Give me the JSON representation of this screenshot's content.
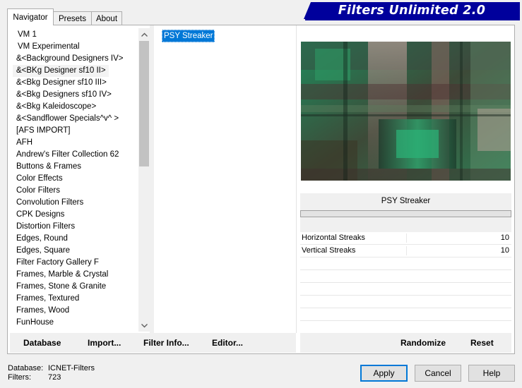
{
  "app": {
    "title": "Filters Unlimited 2.0"
  },
  "tabs": [
    {
      "label": "Navigator"
    },
    {
      "label": "Presets"
    },
    {
      "label": "About"
    }
  ],
  "categories": [
    "VM 1",
    "VM Experimental",
    "&<Background Designers IV>",
    "&<BKg Designer sf10 II>",
    "&<Bkg Designer sf10 III>",
    "&<Bkg Designers sf10 IV>",
    "&<Bkg Kaleidoscope>",
    "&<Sandflower Specials^v^ >",
    "[AFS IMPORT]",
    "AFH",
    "Andrew's Filter Collection 62",
    "Buttons & Frames",
    "Color Effects",
    "Color Filters",
    "Convolution Filters",
    "CPK Designs",
    "Distortion Filters",
    "Edges, Round",
    "Edges, Square",
    "Filter Factory Gallery F",
    "Frames, Marble & Crystal",
    "Frames, Stone & Granite",
    "Frames, Textured",
    "Frames, Wood",
    "FunHouse"
  ],
  "filters": [
    "PSY Streaker"
  ],
  "params": {
    "title": "PSY Streaker",
    "rows": [
      {
        "name": "Horizontal Streaks",
        "value": "10"
      },
      {
        "name": "Vertical Streaks",
        "value": "10"
      }
    ]
  },
  "actions_left": {
    "database": "Database",
    "import": "Import...",
    "filter_info": "Filter Info...",
    "editor": "Editor..."
  },
  "actions_right": {
    "randomize": "Randomize",
    "reset": "Reset"
  },
  "footer": {
    "database_label": "Database:",
    "database_value": "ICNET-Filters",
    "filters_label": "Filters:",
    "filters_value": "723"
  },
  "buttons": {
    "apply": "Apply",
    "cancel": "Cancel",
    "help": "Help"
  },
  "colors": {
    "banner": "#00009c",
    "selection": "#0078d7"
  },
  "icons": {
    "scroll_up": "chevron-up-icon",
    "scroll_down": "chevron-down-icon"
  }
}
